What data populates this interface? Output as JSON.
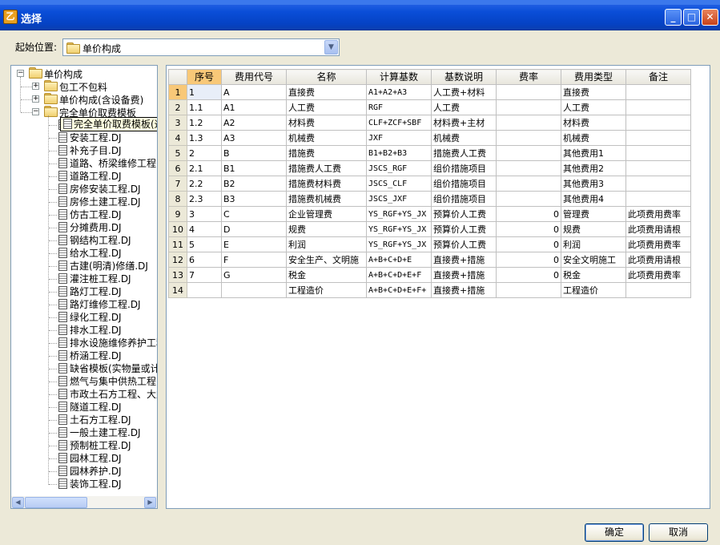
{
  "window": {
    "title": "选择",
    "icon_glyph": "乙"
  },
  "location": {
    "label": "起始位置:",
    "value": "单价构成"
  },
  "tree": {
    "root": "单价构成",
    "folders": [
      "包工不包料",
      "单价构成(含设备费)",
      "完全单价取费模板"
    ],
    "files": [
      "完全单价取费模板(通用).DJ",
      "安装工程.DJ",
      "补充子目.DJ",
      "道路、桥梁维修工程.DJ",
      "道路工程.DJ",
      "房修安装工程.DJ",
      "房修土建工程.DJ",
      "仿古工程.DJ",
      "分摊费用.DJ",
      "钢结构工程.DJ",
      "给水工程.DJ",
      "古建(明清)修缮.DJ",
      "灌注桩工程.DJ",
      "路灯工程.DJ",
      "路灯维修工程.DJ",
      "绿化工程.DJ",
      "排水工程.DJ",
      "排水设施维修养护工程.DJ",
      "桥涵工程.DJ",
      "缺省模板(实物量或计算).DJ",
      "燃气与集中供热工程.DJ",
      "市政土石方工程、大型.DJ",
      "隧道工程.DJ",
      "土石方工程.DJ",
      "一般土建工程.DJ",
      "预制桩工程.DJ",
      "园林工程.DJ",
      "园林养护.DJ",
      "装饰工程.DJ"
    ],
    "tooltip": "完全单价取费模板(通用).DJ"
  },
  "grid": {
    "columns": [
      "",
      "序号",
      "费用代号",
      "名称",
      "计算基数",
      "基数说明",
      "费率",
      "费用类型",
      "备注"
    ],
    "rows": [
      [
        "1",
        "1",
        "A",
        "直接费",
        "A1+A2+A3",
        "人工费+材料",
        "",
        "直接费",
        ""
      ],
      [
        "2",
        "1.1",
        "A1",
        "人工费",
        "RGF",
        "人工费",
        "",
        "人工费",
        ""
      ],
      [
        "3",
        "1.2",
        "A2",
        "材料费",
        "CLF+ZCF+SBF",
        "材料费+主材",
        "",
        "材料费",
        ""
      ],
      [
        "4",
        "1.3",
        "A3",
        "机械费",
        "JXF",
        "机械费",
        "",
        "机械费",
        ""
      ],
      [
        "5",
        "2",
        "B",
        "措施费",
        "B1+B2+B3",
        "措施费人工费",
        "",
        "其他费用1",
        ""
      ],
      [
        "6",
        "2.1",
        "B1",
        "措施费人工费",
        "JSCS_RGF",
        "组价措施项目",
        "",
        "其他费用2",
        ""
      ],
      [
        "7",
        "2.2",
        "B2",
        "措施费材料费",
        "JSCS_CLF",
        "组价措施项目",
        "",
        "其他费用3",
        ""
      ],
      [
        "8",
        "2.3",
        "B3",
        "措施费机械费",
        "JSCS_JXF",
        "组价措施项目",
        "",
        "其他费用4",
        ""
      ],
      [
        "9",
        "3",
        "C",
        "企业管理费",
        "YS_RGF+YS_JX",
        "预算价人工费",
        "0",
        "管理费",
        "此项费用费率"
      ],
      [
        "10",
        "4",
        "D",
        "规费",
        "YS_RGF+YS_JX",
        "预算价人工费",
        "0",
        "规费",
        "此项费用请根"
      ],
      [
        "11",
        "5",
        "E",
        "利润",
        "YS_RGF+YS_JX",
        "预算价人工费",
        "0",
        "利润",
        "此项费用费率"
      ],
      [
        "12",
        "6",
        "F",
        "安全生产、文明施",
        "A+B+C+D+E",
        "直接费+措施",
        "0",
        "安全文明施工",
        "此项费用请根"
      ],
      [
        "13",
        "7",
        "G",
        "税金",
        "A+B+C+D+E+F",
        "直接费+措施",
        "0",
        "税金",
        "此项费用费率"
      ],
      [
        "14",
        "",
        "",
        "工程造价",
        "A+B+C+D+E+F+",
        "直接费+措施",
        "",
        "工程造价",
        ""
      ]
    ]
  },
  "buttons": {
    "ok": "确定",
    "cancel": "取消"
  },
  "colors": {
    "title_bar": "#0a4ed8",
    "selected_header": "#f8c878",
    "dialog_bg": "#ece9d8"
  }
}
